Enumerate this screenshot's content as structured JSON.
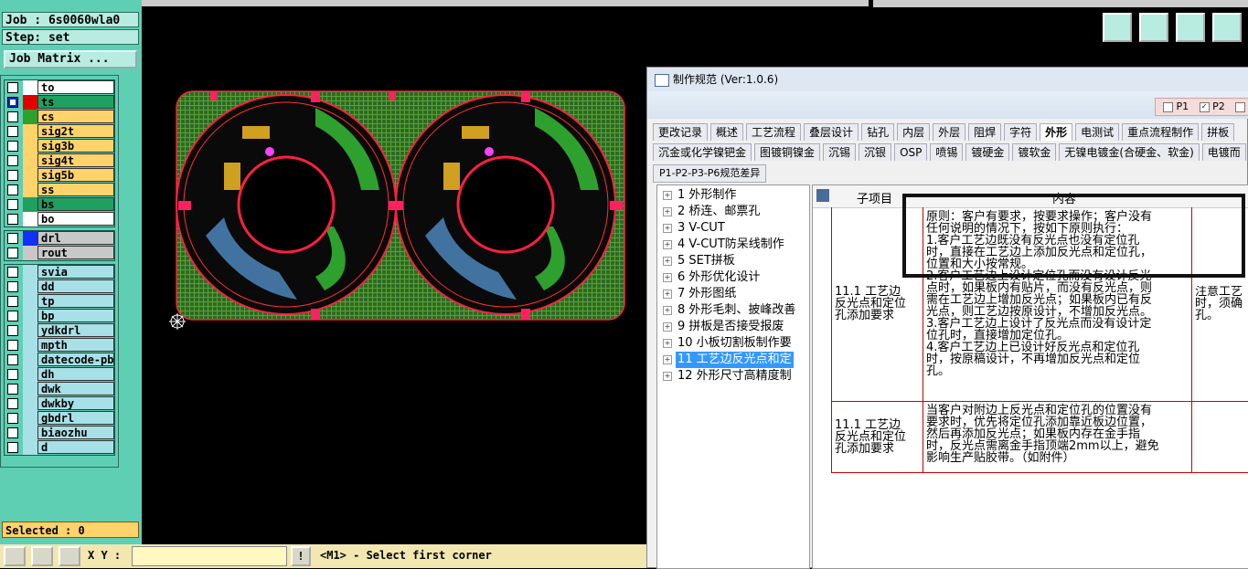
{
  "left_panel": {
    "job": "Job : 6s0060wla0",
    "step": "Step: set",
    "job_matrix": "Job Matrix ...",
    "board_layers": [
      {
        "name": "to",
        "bg": "#ffffff",
        "swatch": "#ffffff",
        "checked": false
      },
      {
        "name": "ts",
        "bg": "#20a060",
        "swatch": "#e00000",
        "checked": true
      },
      {
        "name": "cs",
        "bg": "#ffd36b",
        "swatch": "#2ea02e",
        "checked": false
      },
      {
        "name": "sig2t",
        "bg": "#ffd36b",
        "swatch": "#ffd36b",
        "checked": false
      },
      {
        "name": "sig3b",
        "bg": "#ffd36b",
        "swatch": "#ffd36b",
        "checked": false
      },
      {
        "name": "sig4t",
        "bg": "#ffd36b",
        "swatch": "#ffd36b",
        "checked": false
      },
      {
        "name": "sig5b",
        "bg": "#ffd36b",
        "swatch": "#ffd36b",
        "checked": false
      },
      {
        "name": "ss",
        "bg": "#ffd36b",
        "swatch": "#ffd36b",
        "checked": false
      },
      {
        "name": "bs",
        "bg": "#20a060",
        "swatch": "#20a060",
        "checked": false
      },
      {
        "name": "bo",
        "bg": "#ffffff",
        "swatch": "#ffffff",
        "checked": false
      }
    ],
    "drill_layers": [
      {
        "name": "drl",
        "bg": "#c8c8c8",
        "swatch": "#1030ff",
        "checked": false
      },
      {
        "name": "rout",
        "bg": "#c8c8c8",
        "swatch": "#c8c8c8",
        "checked": false
      }
    ],
    "misc_layers": [
      {
        "name": "svia",
        "bg": "#a8e0e8"
      },
      {
        "name": "dd",
        "bg": "#a8e0e8"
      },
      {
        "name": "tp",
        "bg": "#a8e0e8"
      },
      {
        "name": "bp",
        "bg": "#a8e0e8"
      },
      {
        "name": "ydkdrl",
        "bg": "#a8e0e8"
      },
      {
        "name": "mpth",
        "bg": "#a8e0e8"
      },
      {
        "name": "datecode-pbo",
        "bg": "#a8e0e8"
      },
      {
        "name": "dh",
        "bg": "#a8e0e8"
      },
      {
        "name": "dwk",
        "bg": "#a8e0e8"
      },
      {
        "name": "dwkby",
        "bg": "#a8e0e8"
      },
      {
        "name": "gbdrl",
        "bg": "#a8e0e8"
      },
      {
        "name": "biaozhu",
        "bg": "#a8e0e8"
      },
      {
        "name": "d",
        "bg": "#a8e0e8"
      }
    ],
    "selected": "Selected : 0"
  },
  "bottom_bar": {
    "xy_label": "X Y :",
    "xy_value": "",
    "warn": "!",
    "prompt": "<M1> - Select first corner"
  },
  "dialog": {
    "title": "制作规范 (Ver:1.0.6)",
    "p_options": [
      {
        "label": "P1",
        "checked": false
      },
      {
        "label": "P2",
        "checked": true
      }
    ],
    "tabs_row1": [
      "更改记录",
      "概述",
      "工艺流程",
      "叠层设计",
      "钻孔",
      "内层",
      "外层",
      "阻焊",
      "字符",
      "外形",
      "电测试",
      "重点流程制作",
      "拼板"
    ],
    "active_tab": "外形",
    "tabs_row2": [
      "沉金或化学镍钯金",
      "图镀铜镍金",
      "沉锡",
      "沉银",
      "OSP",
      "喷锡",
      "镀硬金",
      "镀软金",
      "无镍电镀金(合硬金、软金)",
      "电镀而"
    ],
    "tab_row3": "P1-P2-P3-P6规范差异",
    "tree": [
      {
        "label": "1 外形制作",
        "selected": false
      },
      {
        "label": "2 桥连、邮票孔",
        "selected": false
      },
      {
        "label": "3 V-CUT",
        "selected": false
      },
      {
        "label": "4 V-CUT防呆线制作",
        "selected": false
      },
      {
        "label": "5 SET拼板",
        "selected": false
      },
      {
        "label": "6 外形优化设计",
        "selected": false
      },
      {
        "label": "7 外形图纸",
        "selected": false
      },
      {
        "label": "8 外形毛刺、披峰改善",
        "selected": false
      },
      {
        "label": "9 拼板是否接受报废",
        "selected": false
      },
      {
        "label": "10 小板切割板制作要",
        "selected": false
      },
      {
        "label": "11 工艺边反光点和定",
        "selected": true
      },
      {
        "label": "12 外形尺寸高精度制",
        "selected": false
      }
    ],
    "table": {
      "col_sub": "子项目",
      "col_content": "内容",
      "row1": {
        "sub": [
          "11.1 工艺边",
          "反光点和定位",
          "孔添加要求"
        ],
        "content": [
          "原则：客户有要求，按要求操作；客户没有",
          "任何说明的情况下，按如下原则执行：",
          "1.客户工艺边既没有反光点也没有定位孔",
          "时，直接在工艺边上添加反光点和定位孔，",
          "位置和大小按常规。",
          "2.客户工艺边上设计定位孔而没有设计反光",
          "点时，如果板内有贴片，而没有反光点，则",
          "需在工艺边上增加反光点；如果板内已有反",
          "光点，则工艺边按原设计，不增加反光点。",
          "3.客户工艺边上设计了反光点而没有设计定",
          "位孔时，直接增加定位孔。",
          "4.客户工艺边上已设计好反光点和定位孔",
          "时，按原稿设计，不再增加反光点和定位",
          "孔。"
        ],
        "note": [
          "注意工艺",
          "时，须确",
          "孔。"
        ]
      },
      "row2": {
        "sub": [
          "11.1 工艺边",
          "反光点和定位",
          "孔添加要求"
        ],
        "content": [
          "当客户对附边上反光点和定位孔的位置没有",
          "要求时，优先将定位孔添加靠近板边位置，",
          "然后再添加反光点；如果板内存在金手指",
          "时，反光点需离金手指顶端2mm以上，避免",
          "影响生产贴胶带。（如附件）"
        ]
      }
    }
  }
}
